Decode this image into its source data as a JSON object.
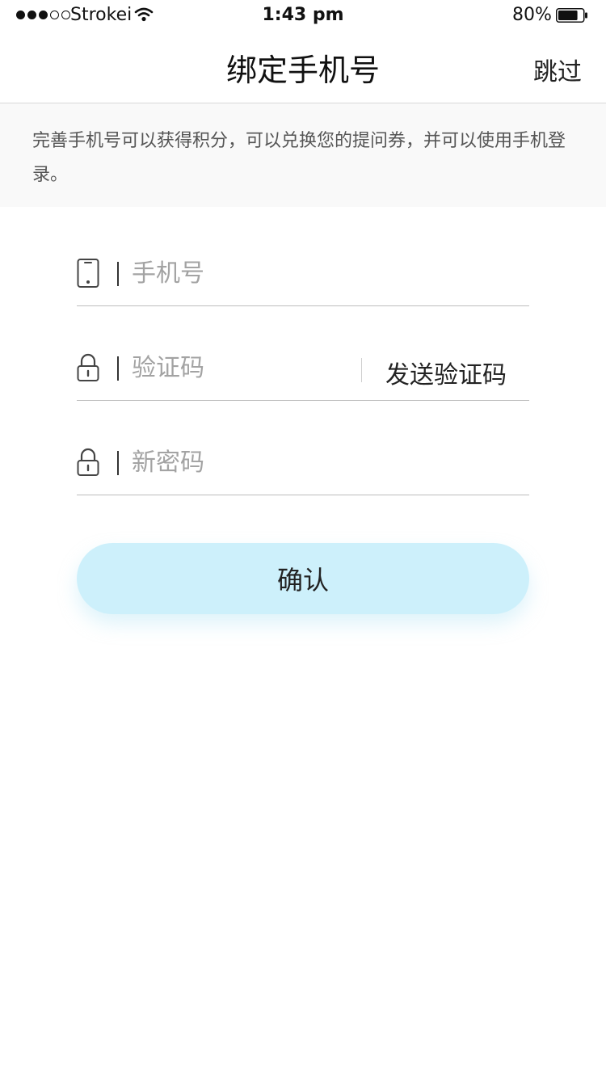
{
  "status_bar": {
    "carrier": "Strokei",
    "time": "1:43 pm",
    "battery": "80%",
    "signal_bars_filled": 3,
    "signal_bars_total": 5,
    "battery_level": 0.8
  },
  "nav": {
    "title": "绑定手机号",
    "skip_label": "跳过"
  },
  "notice": {
    "text": "完善手机号可以获得积分，可以兑换您的提问券，并可以使用手机登录。"
  },
  "form": {
    "phone_placeholder": "手机号",
    "code_placeholder": "验证码",
    "send_code_label": "发送验证码",
    "password_placeholder": "新密码",
    "confirm_label": "确认"
  },
  "colors": {
    "button_bg": "#cdf0fb",
    "notice_bg": "#f9f9f9",
    "placeholder": "#a3a3a3",
    "divider": "#bdbdbd"
  },
  "icons": {
    "phone_field": "smartphone-icon",
    "code_field": "lock-icon",
    "password_field": "lock-icon",
    "wifi": "wifi-icon",
    "battery": "battery-icon"
  }
}
